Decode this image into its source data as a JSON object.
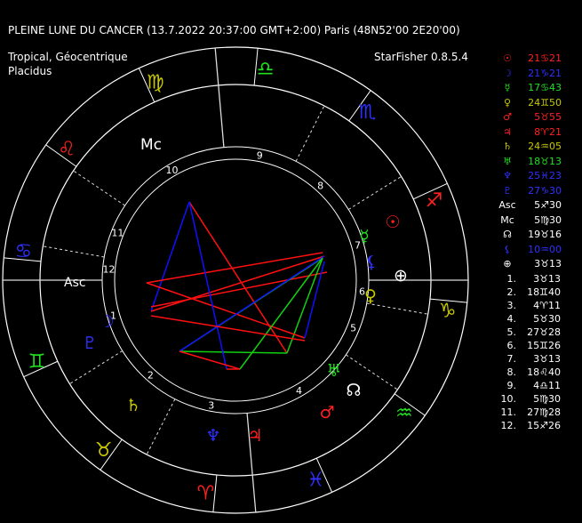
{
  "header": {
    "title": "PLEINE LUNE DU CANCER  (13.7.2022 20:37:00 GMT+2:00) Paris (48N52'00 2E20'00)",
    "zodiac": "Tropical, Géocentrique",
    "houses": "Placidus",
    "software": "StarFisher 0.8.5.4"
  },
  "colors": {
    "fire": "#ff2020",
    "earth": "#c8c800",
    "air": "#20e020",
    "water": "#2020ff",
    "aspect_hard": "#ff1010",
    "aspect_soft": "#1010ff",
    "aspect_green": "#10d010"
  },
  "planets": [
    {
      "name": "sun-icon",
      "glyph": "☉",
      "value": "21♋21",
      "color": "#ff2020"
    },
    {
      "name": "moon-icon",
      "glyph": "☽",
      "value": "21♑21",
      "color": "#3030ff"
    },
    {
      "name": "mercury-icon",
      "glyph": "☿",
      "value": "17♋43",
      "color": "#20e020"
    },
    {
      "name": "venus-icon",
      "glyph": "♀",
      "value": "24♊50",
      "color": "#c8c800"
    },
    {
      "name": "mars-icon",
      "glyph": "♂",
      "value": "5♉55",
      "color": "#ff2020"
    },
    {
      "name": "jupiter-icon",
      "glyph": "♃",
      "value": "8♈21",
      "color": "#ff2020"
    },
    {
      "name": "saturn-icon",
      "glyph": "♄",
      "value": "24♒05",
      "color": "#c8c800"
    },
    {
      "name": "uranus-icon",
      "glyph": "♅",
      "value": "18♉13",
      "color": "#20e020"
    },
    {
      "name": "neptune-icon",
      "glyph": "♆",
      "value": "25♓23",
      "color": "#3030ff"
    },
    {
      "name": "pluto-icon",
      "glyph": "♇",
      "value": "27♑30",
      "color": "#3030ff"
    },
    {
      "name": "ascendant-label",
      "glyph": "Asc",
      "value": "5♐30",
      "color": "#ffffff"
    },
    {
      "name": "midheaven-label",
      "glyph": "Mc",
      "value": "5♍30",
      "color": "#ffffff"
    },
    {
      "name": "node-icon",
      "glyph": "☊",
      "value": "19♉16",
      "color": "#ffffff"
    },
    {
      "name": "lilith-icon",
      "glyph": "⚸",
      "value": "10♒00",
      "color": "#3030ff"
    },
    {
      "name": "fortune-icon",
      "glyph": "⊕",
      "value": "3♉13",
      "color": "#ffffff"
    }
  ],
  "house_cusps": [
    {
      "num": "1.",
      "value": "3♉13"
    },
    {
      "num": "2.",
      "value": "18♊40"
    },
    {
      "num": "3.",
      "value": "4♈11"
    },
    {
      "num": "4.",
      "value": "5♉30"
    },
    {
      "num": "5.",
      "value": "27♉28"
    },
    {
      "num": "6.",
      "value": "15♊26"
    },
    {
      "num": "7.",
      "value": "3♉13"
    },
    {
      "num": "8.",
      "value": "18♌40"
    },
    {
      "num": "9.",
      "value": "4♎11"
    },
    {
      "num": "10.",
      "value": "5♍30"
    },
    {
      "num": "11.",
      "value": "27♍28"
    },
    {
      "num": "12.",
      "value": "15♐26"
    }
  ],
  "zodiac_signs": [
    {
      "name": "libra-icon",
      "glyph": "♎",
      "color": "#20e020"
    },
    {
      "name": "virgo-icon",
      "glyph": "♍",
      "color": "#c8c800"
    },
    {
      "name": "leo-icon",
      "glyph": "♌",
      "color": "#ff2020"
    },
    {
      "name": "cancer-icon",
      "glyph": "♋",
      "color": "#3030ff"
    },
    {
      "name": "gemini-icon",
      "glyph": "♊",
      "color": "#20e020"
    },
    {
      "name": "taurus-icon",
      "glyph": "♉",
      "color": "#c8c800"
    },
    {
      "name": "aries-icon",
      "glyph": "♈",
      "color": "#ff2020"
    },
    {
      "name": "pisces-icon",
      "glyph": "♓",
      "color": "#3030ff"
    },
    {
      "name": "aquarius-icon",
      "glyph": "♒",
      "color": "#20e020"
    },
    {
      "name": "capricorn-icon",
      "glyph": "♑",
      "color": "#c8c800"
    },
    {
      "name": "sagittarius-icon",
      "glyph": "♐",
      "color": "#ff2020"
    },
    {
      "name": "scorpio-icon",
      "glyph": "♏",
      "color": "#3030ff"
    }
  ],
  "wheel": {
    "asc_label": "Asc",
    "mc_label": "Mc",
    "house_numbers": [
      "1",
      "2",
      "3",
      "4",
      "5",
      "6",
      "7",
      "8",
      "9",
      "10",
      "11",
      "12"
    ],
    "chart_planets": [
      {
        "name": "chart-moon-icon",
        "glyph": "☽",
        "color": "#3030ff"
      },
      {
        "name": "chart-pluto-icon",
        "glyph": "♇",
        "color": "#3030ff"
      },
      {
        "name": "chart-saturn-icon",
        "glyph": "♄",
        "color": "#c8c800"
      },
      {
        "name": "chart-neptune-icon",
        "glyph": "♆",
        "color": "#3030ff"
      },
      {
        "name": "chart-jupiter-icon",
        "glyph": "♃",
        "color": "#ff2020"
      },
      {
        "name": "chart-mars-icon",
        "glyph": "♂",
        "color": "#ff2020"
      },
      {
        "name": "chart-node-icon",
        "glyph": "☊",
        "color": "#ffffff"
      },
      {
        "name": "chart-uranus-icon",
        "glyph": "♅",
        "color": "#20e020"
      },
      {
        "name": "chart-venus-icon",
        "glyph": "♀",
        "color": "#c8c800"
      },
      {
        "name": "chart-fortune-icon",
        "glyph": "⊕",
        "color": "#ffffff"
      },
      {
        "name": "chart-lilith-icon",
        "glyph": "⚸",
        "color": "#3030ff"
      },
      {
        "name": "chart-mercury-icon",
        "glyph": "☿",
        "color": "#20e020"
      },
      {
        "name": "chart-sun-icon",
        "glyph": "☉",
        "color": "#ff2020"
      }
    ]
  }
}
